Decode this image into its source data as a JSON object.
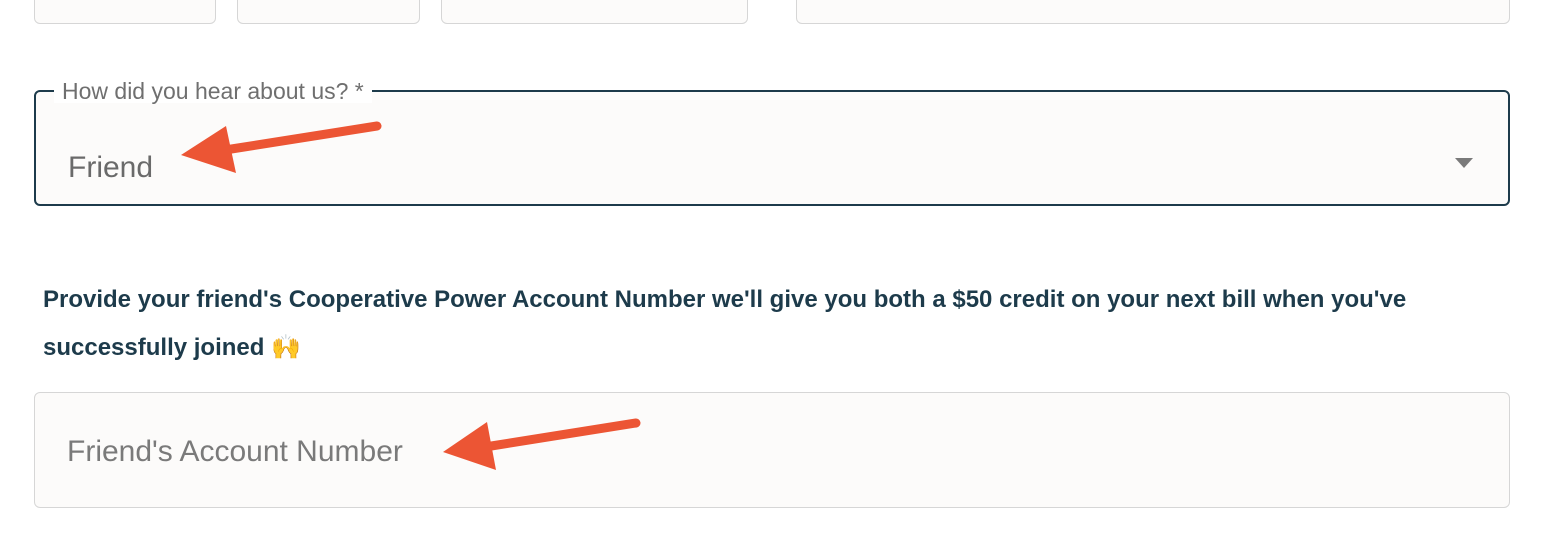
{
  "hear_about": {
    "label": "How did you hear about us? *",
    "selected_value": "Friend"
  },
  "referral": {
    "prompt_text": "Provide your friend's Cooperative Power Account Number we'll give you both a $50 credit on your next bill when you've successfully joined",
    "emoji": "🙌",
    "account_placeholder": "Friend's Account Number",
    "account_value": ""
  },
  "annotation_color": "#ec5534",
  "accent_color": "#1d3b4b"
}
